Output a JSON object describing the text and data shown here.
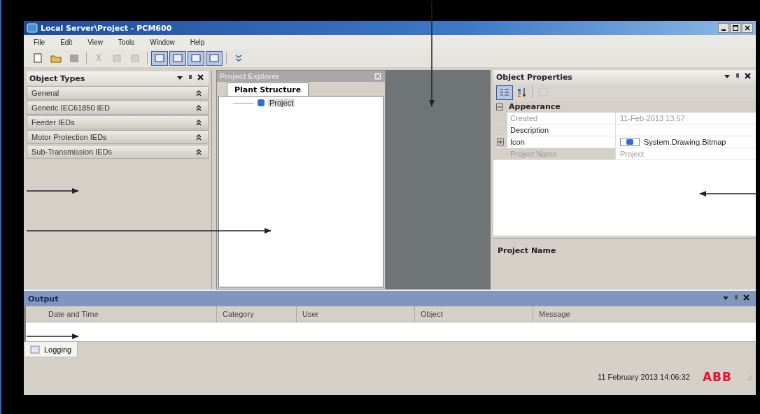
{
  "window": {
    "title": "Local Server\\Project - PCM600"
  },
  "menu": [
    "File",
    "Edit",
    "View",
    "Tools",
    "Window",
    "Help"
  ],
  "toolbar": [
    {
      "pressed": false,
      "disabled": false
    },
    {
      "pressed": false,
      "disabled": false
    },
    {
      "pressed": false,
      "disabled": true
    },
    {
      "pressed": false,
      "disabled": true
    },
    {
      "pressed": false,
      "disabled": true
    },
    {
      "pressed": false,
      "disabled": true
    },
    {
      "pressed": true,
      "disabled": false
    },
    {
      "pressed": true,
      "disabled": false
    },
    {
      "pressed": true,
      "disabled": false
    },
    {
      "pressed": true,
      "disabled": false
    },
    {
      "pressed": false,
      "disabled": false
    }
  ],
  "object_types": {
    "title": "Object Types",
    "items": [
      {
        "label": "General",
        "expanded": false
      },
      {
        "label": "Generic IEC61850 IED",
        "expanded": false
      },
      {
        "label": "Feeder IEDs",
        "expanded": false
      },
      {
        "label": "Motor Protection IEDs",
        "expanded": false
      },
      {
        "label": "Sub-Transmission IEDs",
        "expanded": false
      }
    ]
  },
  "project_explorer": {
    "title": "Project Explorer",
    "tabs": [
      {
        "label": "Plant Structure",
        "selected": true
      }
    ],
    "tree": [
      {
        "label": "Project",
        "selected": true
      }
    ]
  },
  "object_properties": {
    "title": "Object Properties",
    "category": {
      "label": "Appearance",
      "expanded": true
    },
    "rows": [
      {
        "name": "Created",
        "value": "11-Feb-2013 13:57",
        "disabled": true,
        "expandable": false,
        "kind": "text",
        "selected": false
      },
      {
        "name": "Description",
        "disabled": false,
        "expandable": false,
        "kind": "text",
        "selected": false
      },
      {
        "name": "Icon",
        "value": "System.Drawing.Bitmap",
        "disabled": false,
        "expandable": true,
        "kind": "image",
        "selected": false
      },
      {
        "name": "Project Name",
        "value": "Project",
        "disabled": true,
        "expandable": false,
        "kind": "text",
        "selected": true
      }
    ],
    "description": "Project Name"
  },
  "output": {
    "title": "Output",
    "columns": [
      "Date and Time",
      "Category",
      "User",
      "Object",
      "Message"
    ],
    "tabs": [
      {
        "label": "Logging",
        "selected": true
      }
    ]
  },
  "status_bar": {
    "datetime": "11 February 2013 14:06:32",
    "logo": "ABB"
  }
}
